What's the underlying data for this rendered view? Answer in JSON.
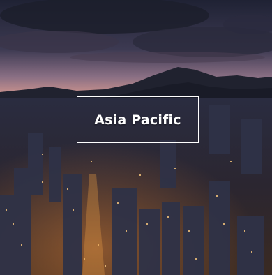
{
  "tile": {
    "label": "Asia Pacific",
    "label_color": "#ffffff",
    "image_subject": "city-skyline-dusk-photo"
  }
}
